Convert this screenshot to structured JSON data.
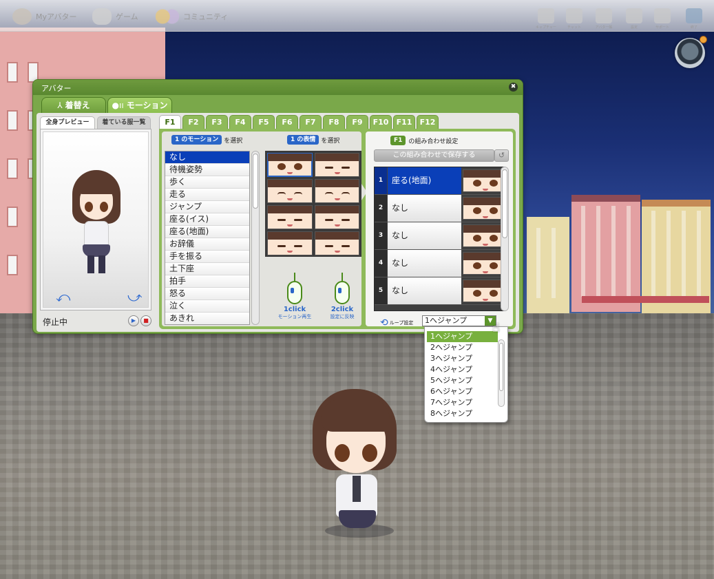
{
  "topbar": {
    "nav": [
      {
        "label": "Myアバター",
        "icon": "avatar-icon"
      },
      {
        "label": "ゲーム",
        "icon": "gamepad-icon"
      },
      {
        "label": "コミュニティ",
        "icon": "community-icon"
      }
    ],
    "tools": [
      {
        "label": "キャプチャー",
        "icon": "camera-icon"
      },
      {
        "label": "チャット",
        "icon": "megaphone-icon"
      },
      {
        "label": "アバター帳",
        "icon": "book-icon"
      },
      {
        "label": "設定",
        "icon": "scissors-icon"
      },
      {
        "label": "サポート",
        "icon": "support-icon"
      },
      {
        "label": "終了",
        "icon": "exit-icon"
      }
    ],
    "map_button_icon": "map-icon"
  },
  "avatar_window": {
    "title": "アバター",
    "close_symbol": "✖",
    "tabs": {
      "dressup": "着替え",
      "motion": "モーション",
      "dressup_glyph": "⅄",
      "motion_glyph": "●ıı"
    },
    "preview": {
      "tab_full": "全身プレビュー",
      "tab_wearing": "着ている服一覧",
      "rotate_left": "⤺",
      "rotate_right": "⤻",
      "status": "停止中",
      "play": "▶",
      "stop": "■"
    },
    "function_tabs": [
      "F1",
      "F2",
      "F3",
      "F4",
      "F5",
      "F6",
      "F7",
      "F8",
      "F9",
      "F10",
      "F11",
      "F12"
    ],
    "active_function_tab": "F1",
    "motion_section": {
      "pill": "1 のモーション",
      "suffix": "を選択",
      "items": [
        "なし",
        "待機姿勢",
        "歩く",
        "走る",
        "ジャンプ",
        "座る(イス)",
        "座る(地面)",
        "お辞儀",
        "手を振る",
        "土下座",
        "拍手",
        "怒る",
        "泣く",
        "あきれ"
      ],
      "selected": "なし"
    },
    "expression_section": {
      "pill": "1 の表情",
      "suffix": "を選択",
      "faces": [
        "normal",
        "closed",
        "smile",
        "smile",
        "closed",
        "closed",
        "closed",
        "closed"
      ]
    },
    "hints": [
      {
        "count": "1click",
        "desc": "モーション再生"
      },
      {
        "count": "2click",
        "desc": "設定に反映"
      }
    ],
    "combo_section": {
      "pill": "F1",
      "label": "の組み合わせ設定",
      "save_button": "この組み合わせで保存する",
      "reset_symbol": "↺",
      "rows": [
        {
          "num": "1",
          "motion": "座る(地面)"
        },
        {
          "num": "2",
          "motion": "なし"
        },
        {
          "num": "3",
          "motion": "なし"
        },
        {
          "num": "4",
          "motion": "なし"
        },
        {
          "num": "5",
          "motion": "なし"
        }
      ],
      "selected_row": "1",
      "loop_label": "ループ設定",
      "loop_value": "1へジャンプ",
      "loop_arrow": "▼"
    }
  },
  "jump_dropdown": {
    "options": [
      "1へジャンプ",
      "2へジャンプ",
      "3へジャンプ",
      "4へジャンプ",
      "5へジャンプ",
      "6へジャンプ",
      "7へジャンプ",
      "8へジャンプ"
    ],
    "selected": "1へジャンプ"
  },
  "colors": {
    "window_green": "#7aa84a",
    "selection_blue": "#0a3fb8",
    "accent_blue": "#2a66c8"
  }
}
